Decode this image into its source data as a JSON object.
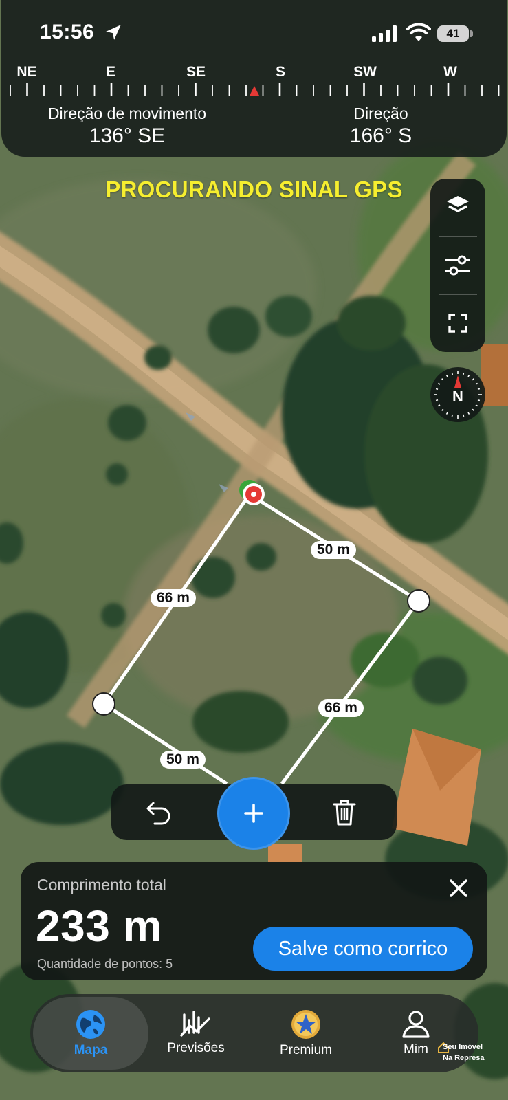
{
  "status_bar": {
    "time": "15:56",
    "battery": "41"
  },
  "compass": {
    "directions": [
      "NE",
      "E",
      "SE",
      "S",
      "SW",
      "W"
    ],
    "movement_direction_label": "Direção de movimento",
    "movement_direction_value": "136° SE",
    "heading_label": "Direção",
    "heading_value": "166° S"
  },
  "gps_banner": "PROCURANDO SINAL GPS",
  "map_controls": {
    "icons": [
      "layers-icon",
      "sliders-icon",
      "fullscreen-icon"
    ],
    "compass_letter": "N"
  },
  "segments": [
    {
      "label": "50 m"
    },
    {
      "label": "66 m"
    },
    {
      "label": "66 m"
    },
    {
      "label": "50 m"
    }
  ],
  "summary": {
    "title": "Comprimento total",
    "total": "233 m",
    "points": "Quantidade de pontos: 5",
    "save_label": "Salve como corrico"
  },
  "tabs": [
    {
      "label": "Mapa",
      "icon": "globe-icon",
      "active": true
    },
    {
      "label": "Previsões",
      "icon": "chart-icon",
      "active": false
    },
    {
      "label": "Premium",
      "icon": "star-icon",
      "active": false
    },
    {
      "label": "Mim",
      "icon": "person-icon",
      "active": false
    }
  ],
  "watermark": {
    "line1": "Seu Imóvel",
    "line2": "Na Represa"
  },
  "colors": {
    "accent": "#1b82e8",
    "gps_warning": "#f6ee2f",
    "compass_needle": "#e53935"
  }
}
